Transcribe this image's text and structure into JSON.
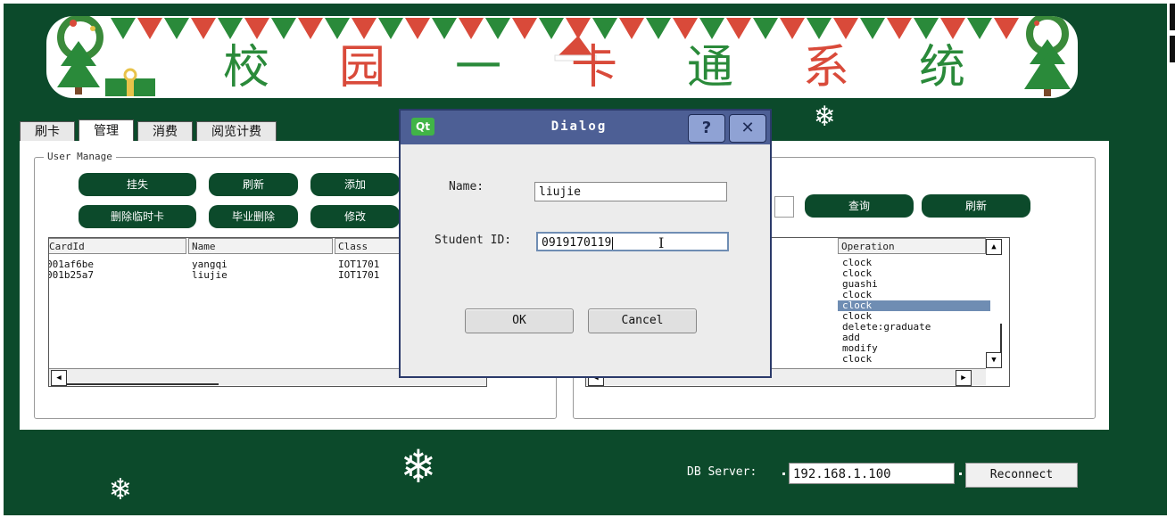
{
  "banner": {
    "title_chars": [
      "校",
      "园",
      "一",
      "卡",
      "通",
      "系",
      "统"
    ],
    "colors": {
      "green": "#2a8a3a",
      "red": "#d94a3a"
    }
  },
  "tabs": [
    "刷卡",
    "管理",
    "消费",
    "阅览计费"
  ],
  "user_manage": {
    "group_title": "User Manage",
    "buttons": {
      "report_loss": "挂失",
      "refresh": "刷新",
      "add": "添加",
      "delete_temp_card": "删除临时卡",
      "graduate_delete": "毕业删除",
      "modify": "修改"
    },
    "table": {
      "headers": [
        "CardId",
        "Name",
        "Class"
      ],
      "rows": [
        [
          "001af6be",
          "yangqi",
          "IOT1701"
        ],
        [
          "001b25a7",
          "liujie",
          "IOT1701"
        ]
      ]
    }
  },
  "log_panel": {
    "buttons": {
      "query": "查询",
      "refresh": "刷新"
    },
    "table": {
      "header": "Operation",
      "rows": [
        "clock",
        "clock",
        "guashi",
        "clock",
        "clock",
        "clock",
        "delete:graduate",
        "add",
        "modify",
        "clock"
      ],
      "selected_index": 4
    }
  },
  "footer": {
    "db_label": "DB Server:",
    "db_value": "192.168.1.100",
    "reconnect": "Reconnect"
  },
  "dialog": {
    "logo": "Qt",
    "title": "Dialog",
    "help_btn": "?",
    "close_btn": "✕",
    "name_label": "Name:",
    "name_value": "liujie",
    "id_label": "Student ID:",
    "id_value": "0919170119",
    "ok": "OK",
    "cancel": "Cancel"
  }
}
